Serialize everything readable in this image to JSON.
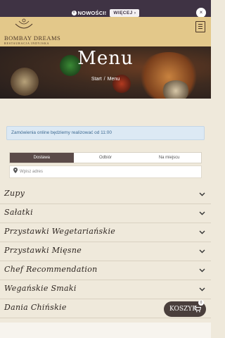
{
  "topbar": {
    "news_label": "NOWOŚCI!",
    "more_label": "WIĘCEJ ›",
    "close_label": "×"
  },
  "header": {
    "brand": "BOMBAY DREAMS",
    "subtitle": "RESTAURACJA INDYJSKA"
  },
  "hero": {
    "title": "Menu",
    "breadcrumb": [
      "Start",
      "Menu"
    ],
    "separator": "/"
  },
  "notice": "Zamówienia online będziemy realizować od 11:00",
  "order_tabs": [
    {
      "label": "Dostawa",
      "active": true
    },
    {
      "label": "Odbiór",
      "active": false
    },
    {
      "label": "Na miejscu",
      "active": false
    }
  ],
  "address": {
    "placeholder": "Wpisz adres"
  },
  "categories": [
    {
      "label": "Zupy"
    },
    {
      "label": "Sałatki"
    },
    {
      "label": "Przystawki Wegetariańskie"
    },
    {
      "label": "Przystawki Mięsne"
    },
    {
      "label": "Chef Recommendation"
    },
    {
      "label": "Wegańskie Smaki"
    },
    {
      "label": "Dania Chińskie"
    }
  ],
  "cart": {
    "label": "KOSZYK",
    "count": "0"
  },
  "colors": {
    "topbar": "#3f3344",
    "header": "#e3c88a",
    "accent": "#5b4b49",
    "notice_bg": "#dce9f4"
  }
}
